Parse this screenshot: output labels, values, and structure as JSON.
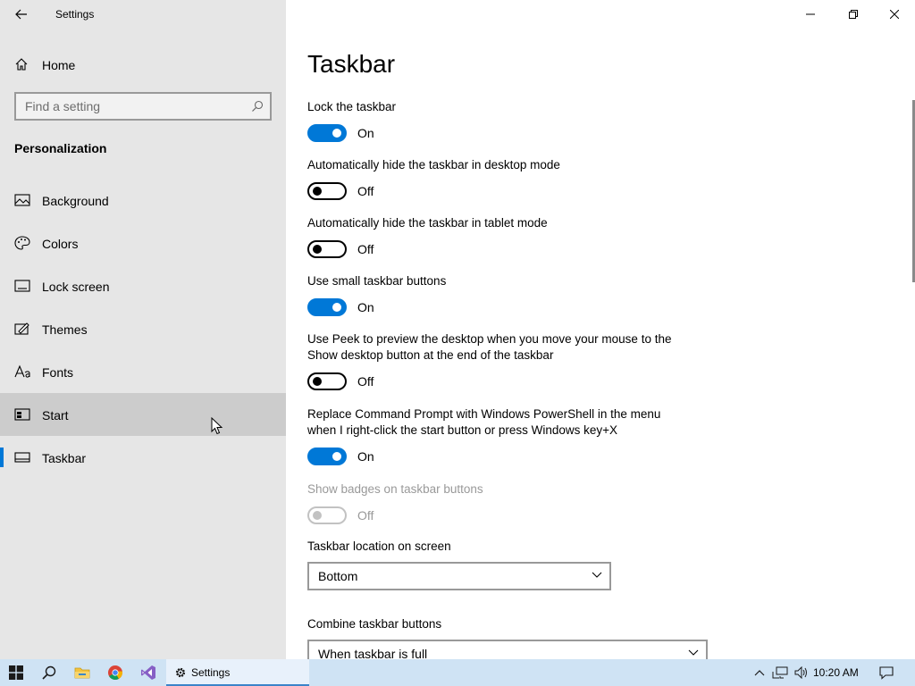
{
  "window": {
    "title": "Settings"
  },
  "sidebar": {
    "home_label": "Home",
    "search": {
      "placeholder": "Find a setting"
    },
    "section_title": "Personalization",
    "items": [
      {
        "label": "Background",
        "icon": "picture-icon"
      },
      {
        "label": "Colors",
        "icon": "palette-icon"
      },
      {
        "label": "Lock screen",
        "icon": "lock-screen-icon"
      },
      {
        "label": "Themes",
        "icon": "themes-icon"
      },
      {
        "label": "Fonts",
        "icon": "fonts-icon"
      },
      {
        "label": "Start",
        "icon": "start-icon"
      },
      {
        "label": "Taskbar",
        "icon": "taskbar-icon"
      }
    ],
    "selected": "Taskbar",
    "hovered": "Start"
  },
  "main": {
    "title": "Taskbar",
    "settings": [
      {
        "label": "Lock the taskbar",
        "state": "On"
      },
      {
        "label": "Automatically hide the taskbar in desktop mode",
        "state": "Off"
      },
      {
        "label": "Automatically hide the taskbar in tablet mode",
        "state": "Off"
      },
      {
        "label": "Use small taskbar buttons",
        "state": "On"
      },
      {
        "label_line1": "Use Peek to preview the desktop when you move your mouse to the",
        "label_line2": "Show desktop button at the end of the taskbar",
        "state": "Off"
      },
      {
        "label_line1": "Replace Command Prompt with Windows PowerShell in the menu",
        "label_line2": "when I right-click the start button or press Windows key+X",
        "state": "On"
      },
      {
        "label": "Show badges on taskbar buttons",
        "state": "Off",
        "disabled": true
      }
    ],
    "location": {
      "label": "Taskbar location on screen",
      "value": "Bottom"
    },
    "combine": {
      "label": "Combine taskbar buttons",
      "value": "When taskbar is full"
    }
  },
  "taskbar": {
    "app_label": "Settings",
    "clock": "10:20 AM"
  },
  "colors": {
    "accent": "#0078d7",
    "sidebar_bg": "#e6e6e6",
    "taskbar_bg": "#cfe3f4"
  }
}
